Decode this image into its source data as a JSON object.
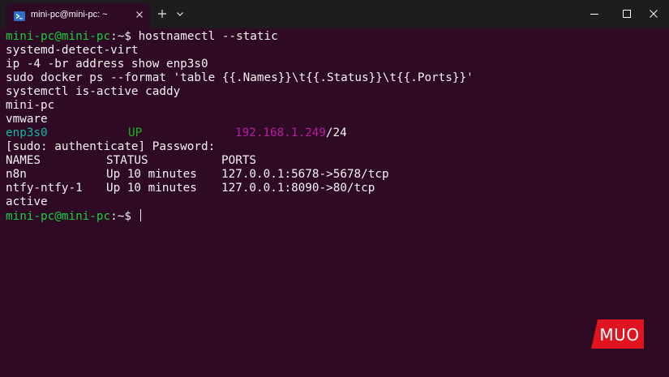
{
  "tab": {
    "title": "mini-pc@mini-pc: ~",
    "icon": "powershell-icon"
  },
  "titlebar": {
    "new_tab_icon": "plus-icon",
    "dropdown_icon": "chevron-down-icon",
    "minimize_icon": "minimize-icon",
    "maximize_icon": "maximize-icon",
    "close_icon": "close-icon"
  },
  "terminal": {
    "prompt": "mini-pc@mini-pc",
    "prompt_sep": ":",
    "prompt_path": "~",
    "prompt_symbol": "$ ",
    "command": "hostnamectl --static",
    "lines": [
      "systemd-detect-virt",
      "ip -4 -br address show enp3s0",
      "sudo docker ps --format 'table {{.Names}}\\t{{.Status}}\\t{{.Ports}}'",
      "systemctl is-active caddy",
      "mini-pc",
      "vmware"
    ],
    "interface": {
      "name": "enp3s0",
      "state": "UP",
      "ip": "192.168.1.249",
      "prefix": "/24"
    },
    "sudo_prompt": "[sudo: authenticate] Password:",
    "docker_table": {
      "headers": [
        "NAMES",
        "STATUS",
        "PORTS"
      ],
      "rows": [
        [
          "n8n",
          "Up 10 minutes",
          "127.0.0.1:5678->5678/tcp"
        ],
        [
          "ntfy-ntfy-1",
          "Up 10 minutes",
          "127.0.0.1:8090->80/tcp"
        ]
      ]
    },
    "caddy_status": "active"
  },
  "watermark": "MUO",
  "colors": {
    "background": "#2f0a24",
    "titlebar": "#1d1d1d",
    "prompt_green": "#13d13c",
    "state_green": "#14b81f",
    "ip_magenta": "#b51ea0",
    "logo_red": "#e0141e"
  }
}
